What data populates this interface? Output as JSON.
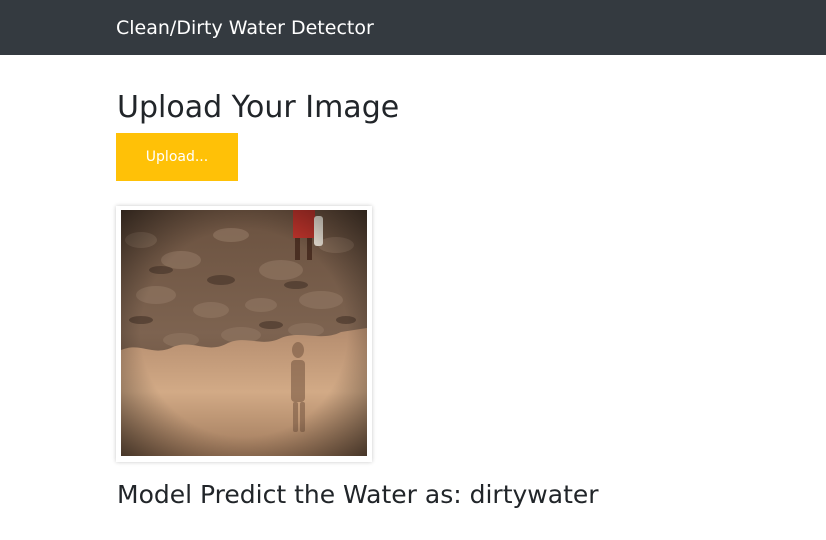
{
  "navbar": {
    "brand": "Clean/Dirty Water Detector"
  },
  "main": {
    "heading": "Upload Your Image",
    "upload_button_label": "Upload...",
    "preview_image": {
      "subject": "person standing on cracked mud beside a muddy water puddle with reflection"
    },
    "result_prefix": "Model Predict the Water as: ",
    "result_value": "dirtywater"
  },
  "colors": {
    "navbar_bg": "#343a40",
    "button_bg": "#ffc107",
    "text": "#212529"
  }
}
